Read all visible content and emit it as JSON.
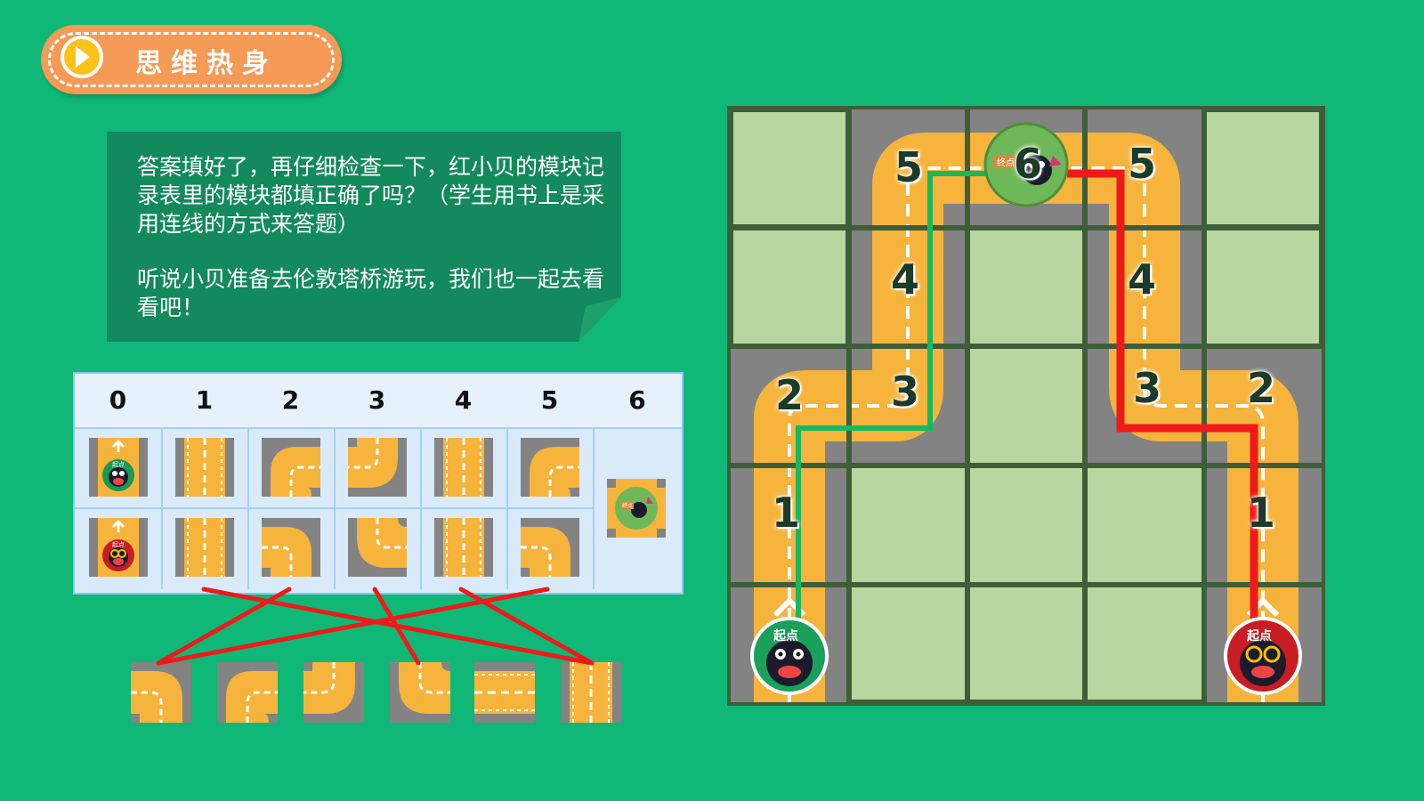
{
  "header": {
    "title": "思维热身"
  },
  "speech": {
    "paragraph1": "答案填好了，再仔细检查一下，红小贝的模块记录表里的模块都填正确了吗？（学生用书上是采用连线的方式来答题）",
    "paragraph2": "听说小贝准备去伦敦塔桥游玩，我们也一起去看看吧！"
  },
  "table": {
    "headers": [
      "0",
      "1",
      "2",
      "3",
      "4",
      "5",
      "6"
    ],
    "green_row": [
      "start-green",
      "straight-vertical",
      "curve-right-down",
      "curve-left-up",
      "straight-vertical",
      "curve-right-down"
    ],
    "red_row": [
      "start-red",
      "straight-vertical",
      "curve-left-down",
      "curve-right-up",
      "straight-vertical",
      "curve-left-down"
    ],
    "finish": "finish-tile"
  },
  "badges": {
    "start": "起点",
    "finish": "终点"
  },
  "bottom_tiles": [
    "curve-left-down",
    "curve-right-down",
    "curve-left-up",
    "curve-right-up",
    "straight-horizontal",
    "straight-vertical"
  ],
  "map": {
    "labels_green": [
      "1",
      "2",
      "3",
      "4",
      "5"
    ],
    "labels_red": [
      "1",
      "2",
      "3",
      "4",
      "5"
    ],
    "finish_label": "6"
  },
  "colors": {
    "background": "#0fb877",
    "road": "#f6b43c",
    "grass": "#b6d8a0",
    "green_path": "#17b85e",
    "red_path": "#ee1a1a",
    "header": "#f59a57"
  }
}
